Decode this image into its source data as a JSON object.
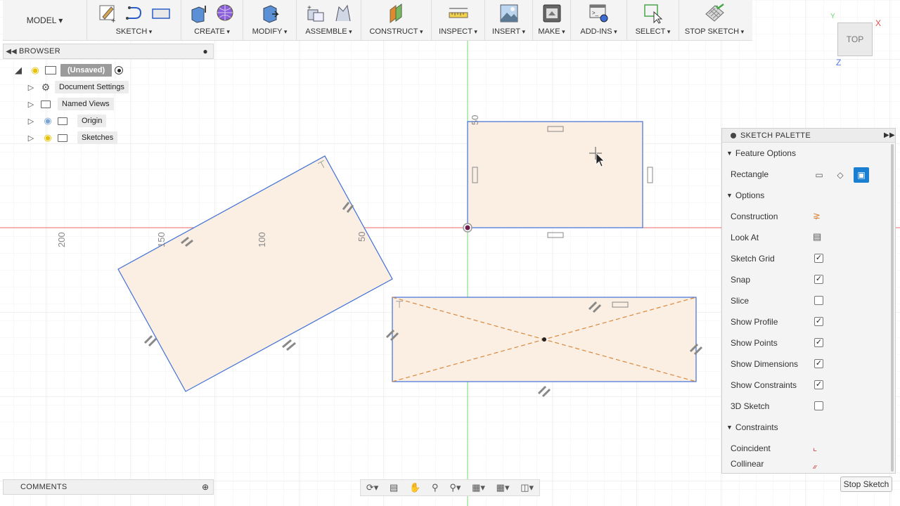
{
  "toolbar": {
    "model_label": "MODEL ▾",
    "groups": [
      {
        "label": "SKETCH"
      },
      {
        "label": "CREATE"
      },
      {
        "label": "MODIFY"
      },
      {
        "label": "ASSEMBLE"
      },
      {
        "label": "CONSTRUCT"
      },
      {
        "label": "INSPECT"
      },
      {
        "label": "INSERT"
      },
      {
        "label": "MAKE"
      },
      {
        "label": "ADD-INS"
      },
      {
        "label": "SELECT"
      },
      {
        "label": "STOP SKETCH"
      }
    ]
  },
  "browser": {
    "title": "BROWSER",
    "root": "(Unsaved)",
    "items": [
      {
        "label": "Document Settings"
      },
      {
        "label": "Named Views"
      },
      {
        "label": "Origin"
      },
      {
        "label": "Sketches"
      }
    ]
  },
  "viewcube": {
    "face": "TOP",
    "x_label": "X",
    "y_label": "Y",
    "z_label": "Z"
  },
  "canvas": {
    "dims": [
      "200",
      "150",
      "100",
      "50",
      "50"
    ]
  },
  "palette": {
    "title": "SKETCH PALETTE",
    "feature_options": "Feature Options",
    "rectangle_label": "Rectangle",
    "options": "Options",
    "rows": [
      {
        "label": "Construction"
      },
      {
        "label": "Look At"
      },
      {
        "label": "Sketch Grid",
        "check": "✓"
      },
      {
        "label": "Snap",
        "check": "✓"
      },
      {
        "label": "Slice",
        "check": ""
      },
      {
        "label": "Show Profile",
        "check": "✓"
      },
      {
        "label": "Show Points",
        "check": "✓"
      },
      {
        "label": "Show Dimensions",
        "check": "✓"
      },
      {
        "label": "Show Constraints",
        "check": "✓"
      },
      {
        "label": "3D Sketch",
        "check": ""
      }
    ],
    "constraints": "Constraints",
    "constraint_rows": [
      {
        "label": "Coincident"
      },
      {
        "label": "Collinear"
      }
    ],
    "stop_button": "Stop Sketch"
  },
  "comments": {
    "title": "COMMENTS"
  },
  "colors": {
    "accent": "#1b7fd1",
    "profile_fill": "#fbeee2",
    "sketch_line": "#3f6fd8"
  }
}
